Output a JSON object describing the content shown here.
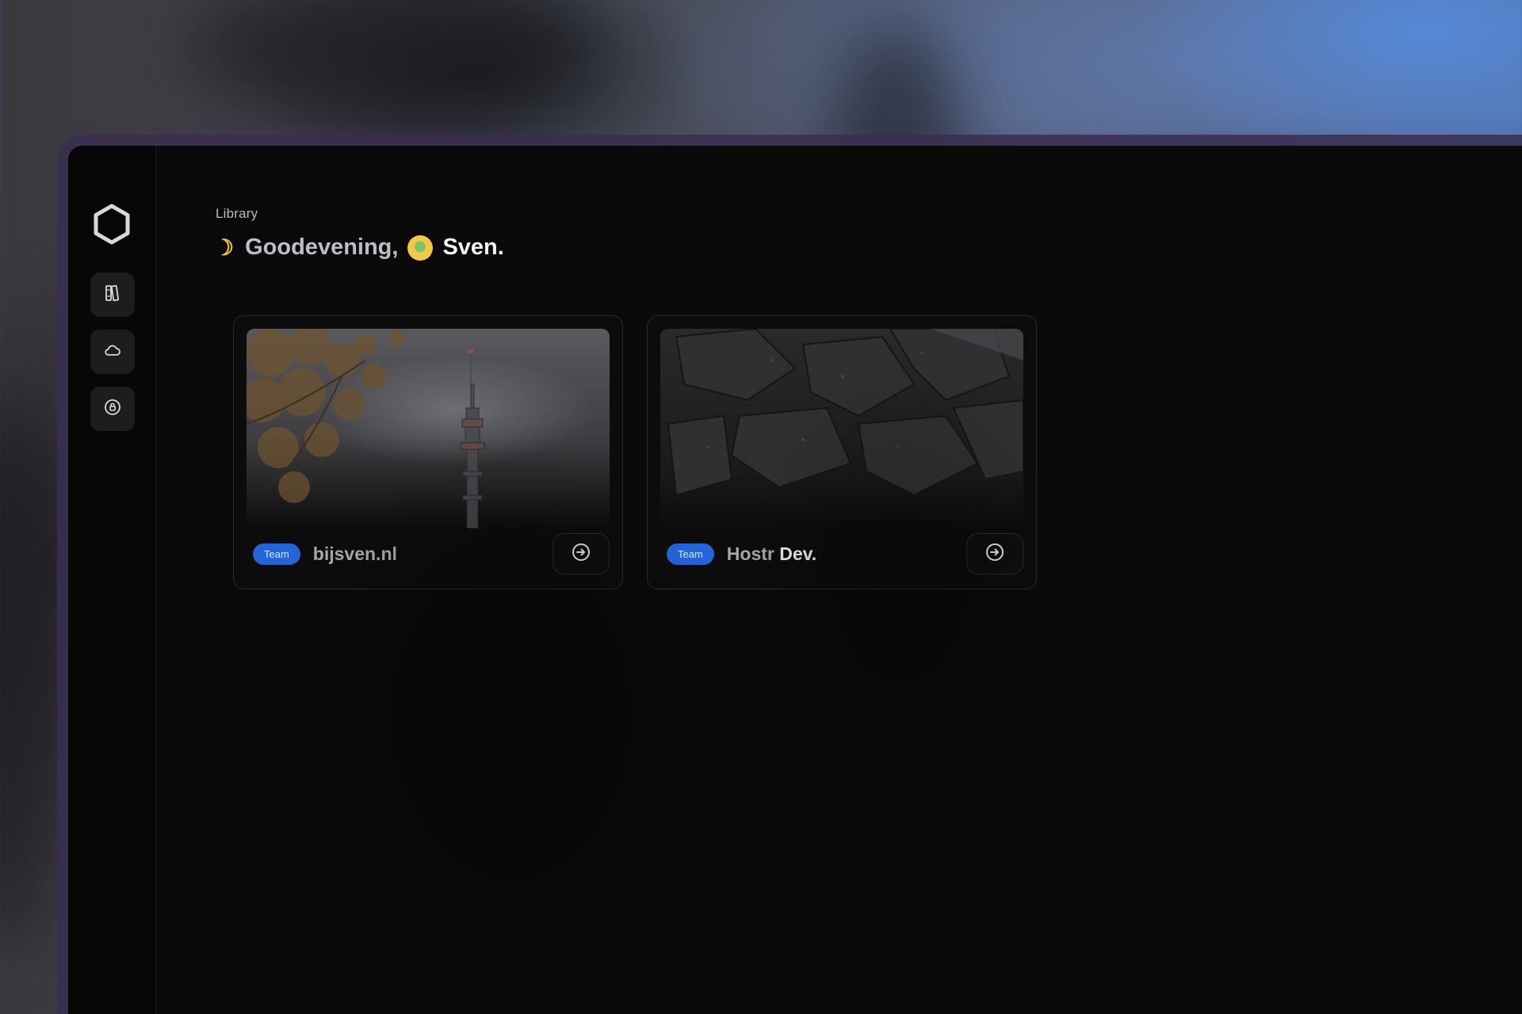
{
  "sidebar": {
    "logo": "hexagon-logo-icon",
    "items": [
      {
        "name": "library",
        "icon": "books-icon"
      },
      {
        "name": "cloud",
        "icon": "cloud-icon"
      },
      {
        "name": "vault",
        "icon": "lock-circle-icon"
      }
    ]
  },
  "header": {
    "breadcrumb": "Library",
    "greeting_icon": "moon-icon",
    "greeting": "Goodevening,",
    "user_name": "Sven."
  },
  "projects": [
    {
      "badge": "Team",
      "title_part1": "bijsven.nl",
      "title_part2": "",
      "image": "foggy-tower-photo",
      "action_icon": "arrow-right-circle-icon"
    },
    {
      "badge": "Team",
      "title_part1": "Hostr ",
      "title_part2": "Dev.",
      "image": "dark-rock-photo",
      "action_icon": "arrow-right-circle-icon"
    }
  ],
  "colors": {
    "accent": "#2563d6",
    "window_bg": "#0a0a0b",
    "window_border": "#3a2e4e"
  }
}
